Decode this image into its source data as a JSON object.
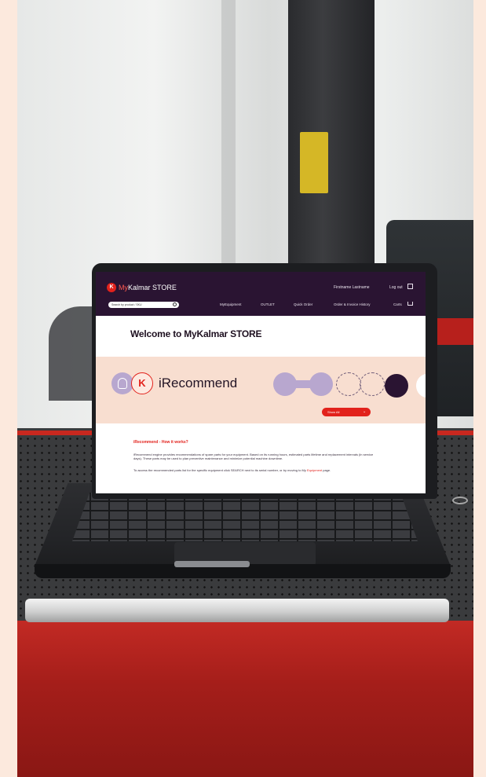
{
  "site": {
    "brand_prefix": "My",
    "brand_rest": "Kalmar STORE",
    "logo_letter": "K",
    "user_name": "Firstname Lastname",
    "logout_label": "Log out",
    "search_placeholder": "Search by product / SKU",
    "nav": [
      "MyEquipment",
      "OUTLET",
      "Quick Order",
      "Order & Invoice History",
      "Carts"
    ],
    "welcome": "Welcome to MyKalmar STORE",
    "irecommend_logo_letter": "K",
    "irecommend_title": "iRecommend",
    "show_label": "Show All",
    "how_title": "iRecommend - How it works?",
    "para1": "iRecommend engine provides recommendations of spare parts for your equipment. Based on its running hours, estimated parts lifetime and replacement intervals (in service days). These parts may be used to plan preventive maintenance and minimize potential machine downtime.",
    "para2_text": "To access the recommended parts list for the specific equipment click SEARCH next to its serial number, or by moving to My",
    "para2_link": "Equipment",
    "para2_end": " page."
  },
  "colors": {
    "header_bg": "#2a1432",
    "accent_red": "#e2221c",
    "banner_bg": "#f8ded0",
    "lavender": "#b8a7cf"
  }
}
